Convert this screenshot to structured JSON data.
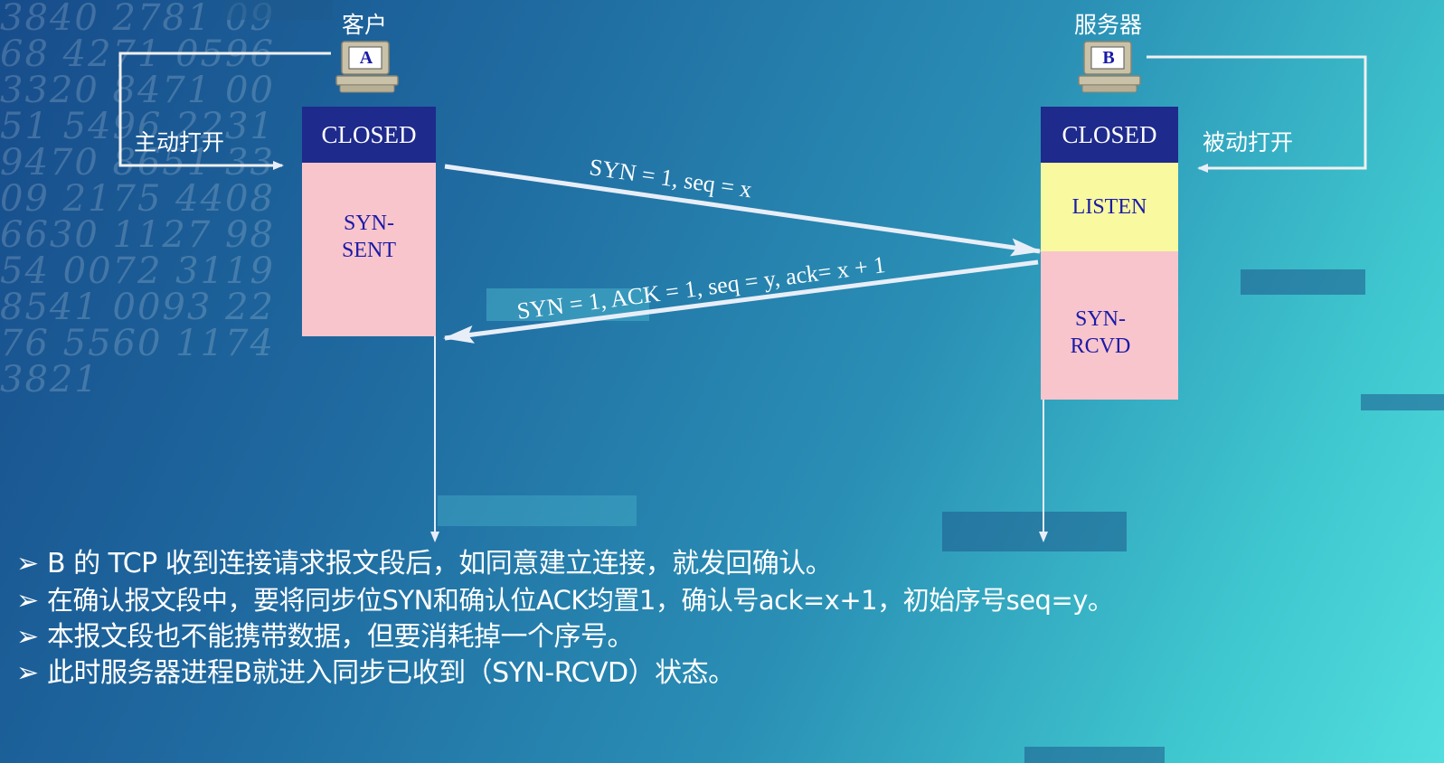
{
  "client": {
    "title": "客户",
    "letter": "A",
    "open_label": "主动打开"
  },
  "server": {
    "title": "服务器",
    "letter": "B",
    "open_label": "被动打开"
  },
  "states": {
    "client_closed": "CLOSED",
    "client_syn_sent": "SYN-\nSENT",
    "server_closed": "CLOSED",
    "server_listen": "LISTEN",
    "server_syn_rcvd": "SYN-\nRCVD"
  },
  "messages": {
    "syn": "SYN = 1, seq = x",
    "synack": "SYN = 1, ACK = 1, seq = y, ack= x + 1"
  },
  "bullets": [
    "B 的 TCP 收到连接请求报文段后，如同意建立连接，就发回确认。",
    "在确认报文段中，要将同步位SYN和确认位ACK均置1，确认号ack=x+1，初始序号seq=y。",
    "本报文段也不能携带数据，但要消耗掉一个序号。",
    "此时服务器进程B就进入同步已收到（SYN-RCVD）状态。"
  ],
  "bullet_marker": "➢",
  "colors": {
    "closed": "#1e2a8c",
    "pink": "#f9c5cc",
    "yellow": "#f9f9a0",
    "state_text": "#1a1aa8"
  },
  "icons": {
    "client": "computer-icon",
    "server": "computer-icon"
  }
}
